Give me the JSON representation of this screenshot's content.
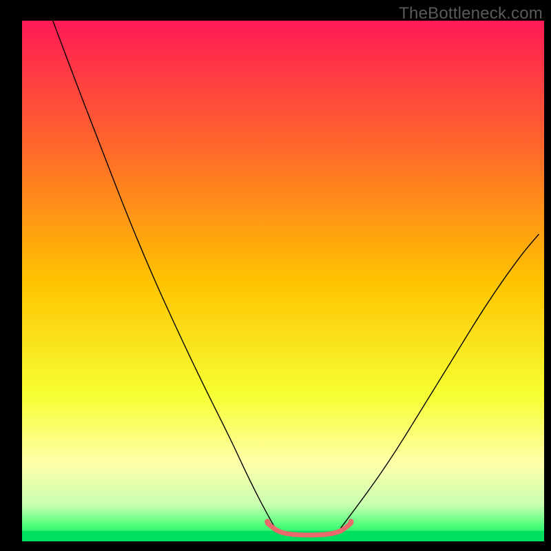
{
  "watermark": "TheBottleneck.com",
  "chart_data": {
    "type": "line",
    "title": "",
    "xlabel": "",
    "ylabel": "",
    "xlim": [
      0,
      100
    ],
    "ylim": [
      0,
      100
    ],
    "gradient_stops": [
      {
        "offset": 0.0,
        "color": "#ff1a55"
      },
      {
        "offset": 0.25,
        "color": "#ff6a2a"
      },
      {
        "offset": 0.5,
        "color": "#ffc300"
      },
      {
        "offset": 0.72,
        "color": "#f6ff33"
      },
      {
        "offset": 0.85,
        "color": "#ffffaa"
      },
      {
        "offset": 0.93,
        "color": "#c8ffb0"
      },
      {
        "offset": 0.97,
        "color": "#4dff7a"
      },
      {
        "offset": 1.0,
        "color": "#00e060"
      }
    ],
    "band_color": "#00e060",
    "band_y_range": [
      0,
      2
    ],
    "series": [
      {
        "name": "left-curve",
        "stroke": "#000000",
        "stroke_width": 1.4,
        "x": [
          5.9,
          10,
          15,
          20,
          25,
          30,
          35,
          40,
          43,
          46,
          48.5
        ],
        "y": [
          100,
          89,
          76,
          63,
          51,
          40,
          29.5,
          19.5,
          13,
          7,
          2.5
        ]
      },
      {
        "name": "right-curve",
        "stroke": "#000000",
        "stroke_width": 1.4,
        "x": [
          61,
          64,
          68,
          72,
          76,
          80,
          84,
          88,
          92,
          96,
          99
        ],
        "y": [
          2.5,
          6.5,
          12,
          18,
          24.5,
          31,
          37.5,
          44,
          50,
          55.5,
          59
        ]
      }
    ],
    "trough_marker": {
      "name": "trough-band",
      "color": "#e86a6a",
      "stroke_width": 7,
      "x": [
        47,
        48.5,
        50,
        52,
        54,
        56,
        58,
        60,
        61.5,
        63
      ],
      "y": [
        3.5,
        2.2,
        1.6,
        1.3,
        1.2,
        1.2,
        1.3,
        1.6,
        2.2,
        3.5
      ],
      "end_dots": [
        {
          "x": 47,
          "y": 3.8,
          "r": 4
        },
        {
          "x": 63,
          "y": 3.8,
          "r": 4
        }
      ]
    }
  }
}
